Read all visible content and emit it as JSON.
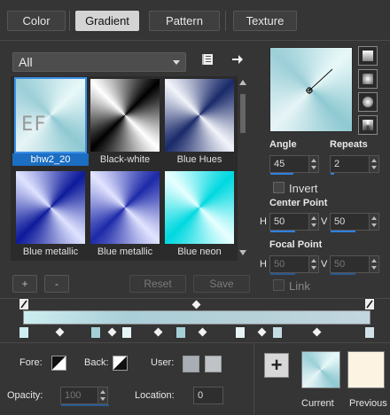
{
  "tabs": [
    {
      "label": "Color"
    },
    {
      "label": "Gradient",
      "active": true
    },
    {
      "label": "Pattern"
    },
    {
      "label": "Texture"
    }
  ],
  "category": {
    "selected": "All"
  },
  "gradients": [
    {
      "name": "bhw2_20",
      "selected": true,
      "overlay": "EF"
    },
    {
      "name": "Black-white"
    },
    {
      "name": "Blue Hues"
    },
    {
      "name": "Blue metallic"
    },
    {
      "name": "Blue metallic"
    },
    {
      "name": "Blue neon"
    }
  ],
  "list_buttons": {
    "add": "+",
    "remove": "-",
    "reset": "Reset",
    "save": "Save"
  },
  "settings": {
    "angle_label": "Angle",
    "angle_value": "45",
    "repeats_label": "Repeats",
    "repeats_value": "2",
    "invert_label": "Invert",
    "center_label": "Center Point",
    "center_h_label": "H",
    "center_h": "50",
    "center_v_label": "V",
    "center_v": "50",
    "focal_label": "Focal Point",
    "focal_h_label": "H",
    "focal_h": "50",
    "focal_v_label": "V",
    "focal_v": "50",
    "link_label": "Link"
  },
  "bottom": {
    "fore_label": "Fore:",
    "back_label": "Back:",
    "user_label": "User:",
    "opacity_label": "Opacity:",
    "opacity_value": "100",
    "location_label": "Location:",
    "location_value": "0",
    "current_label": "Current",
    "previous_label": "Previous"
  },
  "colors": {
    "accent": "#1b6ec2",
    "user_color_1": "#a9adb4",
    "user_color_2": "#bfc2c6",
    "previous_swatch": "#fdf3e2"
  }
}
